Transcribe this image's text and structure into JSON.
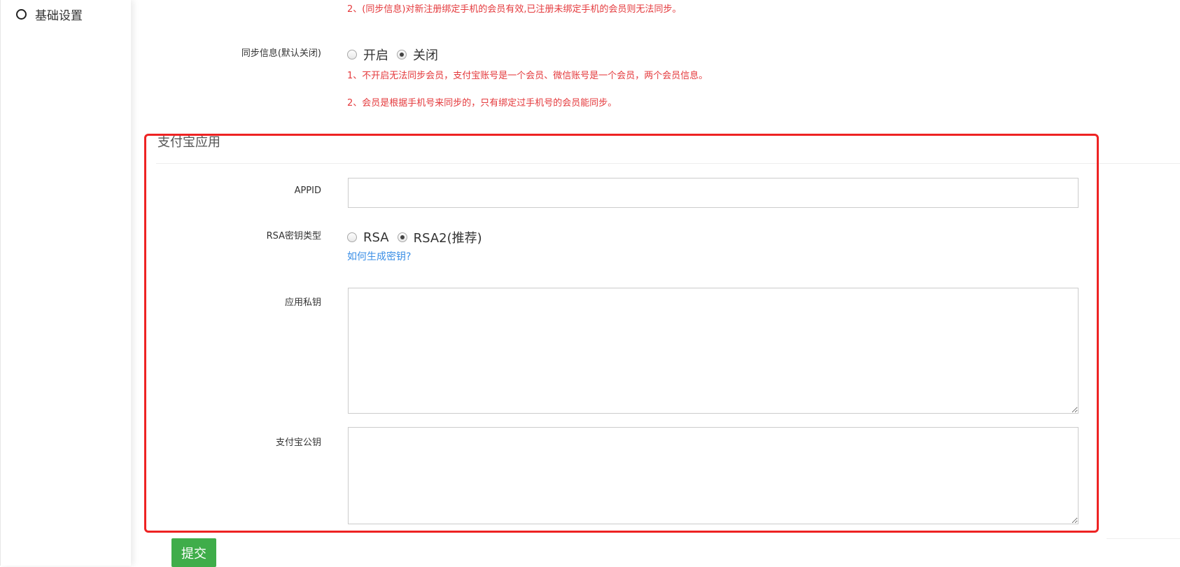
{
  "sidebar": {
    "items": [
      {
        "label": "基础设置",
        "icon": "circle-icon"
      }
    ]
  },
  "sync_section": {
    "top_note": "2、(同步信息)对新注册绑定手机的会员有效,已注册未绑定手机的会员则无法同步。",
    "sync_label": "同步信息(默认关闭)",
    "options": [
      {
        "label": "开启",
        "checked": false
      },
      {
        "label": "关闭",
        "checked": true
      }
    ],
    "notes": [
      "1、不开启无法同步会员，支付宝账号是一个会员、微信账号是一个会员，两个会员信息。",
      "2、会员是根据手机号来同步的，只有绑定过手机号的会员能同步。"
    ]
  },
  "alipay_section": {
    "title": "支付宝应用",
    "appid_label": "APPID",
    "appid_value": "",
    "rsa_label": "RSA密钥类型",
    "rsa_options": [
      {
        "label": "RSA",
        "checked": false
      },
      {
        "label": "RSA2(推荐)",
        "checked": true
      }
    ],
    "help_link": "如何生成密钥?",
    "private_key_label": "应用私钥",
    "private_key_value": "",
    "public_key_label": "支付宝公钥",
    "public_key_value": ""
  },
  "submit_label": "提交",
  "colors": {
    "note_red": "#e4393c",
    "highlight_red": "#ee2323",
    "link_blue": "#3a8ee6",
    "submit_green": "#3fad4a"
  }
}
